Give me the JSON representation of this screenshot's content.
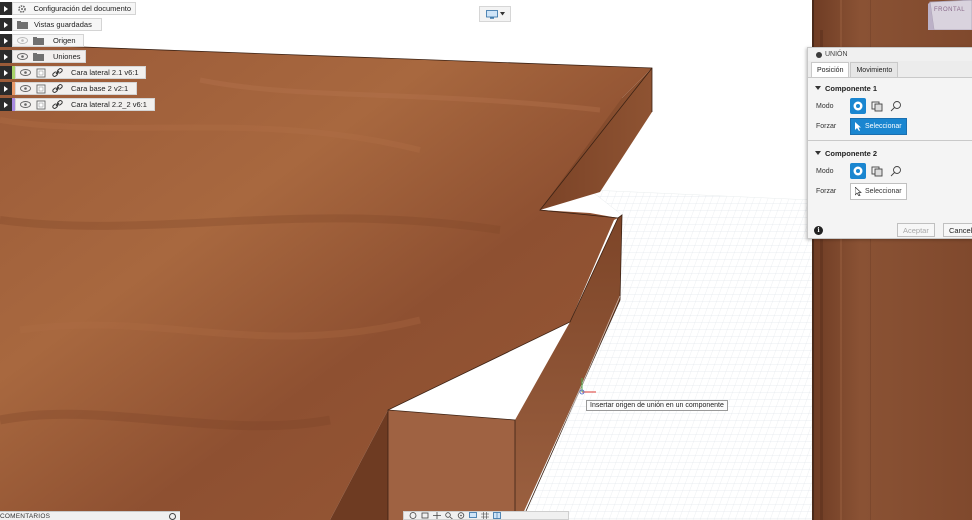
{
  "browser": {
    "items": [
      {
        "label": "Configuración del documento",
        "icon": "gear-icon",
        "visible": false
      },
      {
        "label": "Vistas guardadas",
        "icon": "folder-icon",
        "visible": false
      },
      {
        "label": "Origen",
        "icon": "folder-icon",
        "visible": true,
        "hidden_eye": true
      },
      {
        "label": "Uniones",
        "icon": "folder-icon",
        "visible": true
      },
      {
        "label": "Cara lateral 2.1 v6:1",
        "icon": "component-icon",
        "linked": true,
        "color": "#a8d36a"
      },
      {
        "label": "Cara base 2 v2:1",
        "icon": "component-icon",
        "linked": true,
        "color": "#e89a6a"
      },
      {
        "label": "Cara lateral 2.2_2 v6:1",
        "icon": "component-icon",
        "linked": true,
        "color": "#a88ae0"
      }
    ]
  },
  "viewcube": {
    "label": "FRONTAL"
  },
  "dialog": {
    "title": "UNIÓN",
    "tabs": [
      "Posición",
      "Movimiento"
    ],
    "component1": {
      "title": "Componente 1",
      "mode_label": "Modo",
      "force_label": "Forzar",
      "select_label": "Seleccionar",
      "select_active": true
    },
    "component2": {
      "title": "Componente 2",
      "mode_label": "Modo",
      "force_label": "Forzar",
      "select_label": "Seleccionar",
      "select_active": false
    },
    "accept_label": "Aceptar",
    "cancel_label": "Cancel"
  },
  "tooltip": {
    "text": "Insertar origen de unión en un componente"
  },
  "comments": {
    "label": "COMENTARIOS"
  },
  "colors": {
    "accent": "#1a86d0",
    "wood_light": "#a4633f",
    "wood_mid": "#8f5233",
    "wood_dark": "#6e3b22",
    "grid_line": "#dfe5ea"
  }
}
